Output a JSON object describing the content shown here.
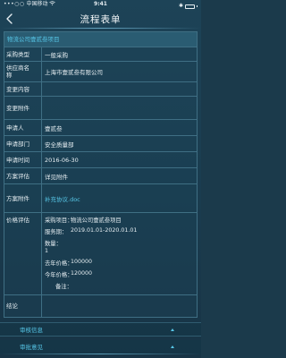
{
  "status_bar": {
    "signal": "•••○○",
    "carrier": "中国移动",
    "time": "9:41",
    "bluetooth": "✱"
  },
  "nav": {
    "title": "流程表单"
  },
  "form": {
    "project_title": "物流公司壹贰叁项目",
    "fields": [
      {
        "label": "采购类型",
        "value": "一般采购"
      },
      {
        "label": "供应商名称",
        "value": "上海市壹贰叁有限公司"
      },
      {
        "label": "变更内容",
        "value": ""
      },
      {
        "label": "变更附件",
        "value": ""
      },
      {
        "label": "申请人",
        "value": "壹贰叁"
      },
      {
        "label": "申请部门",
        "value": "安全质量部"
      },
      {
        "label": "申请时间",
        "value": "2016-06-30"
      },
      {
        "label": "方案评估",
        "value": "详见附件"
      },
      {
        "label": "方案附件",
        "value": "补充协议.doc"
      }
    ],
    "price_eval": {
      "label": "价格评估",
      "items": [
        {
          "key": "采购项目：",
          "value": "物流公司壹贰叁项目"
        },
        {
          "key": "服务期：",
          "value": "2019.01.01-2020.01.01"
        },
        {
          "key": "数量：",
          "value": "1"
        },
        {
          "key": "去年价格：",
          "value": "100000"
        },
        {
          "key": "今年价格：",
          "value": "120000"
        },
        {
          "key": "备注：",
          "value": ""
        }
      ]
    },
    "conclusion_label": "结论"
  },
  "sections": [
    {
      "label": "审核信息"
    },
    {
      "label": "审批意见"
    }
  ]
}
